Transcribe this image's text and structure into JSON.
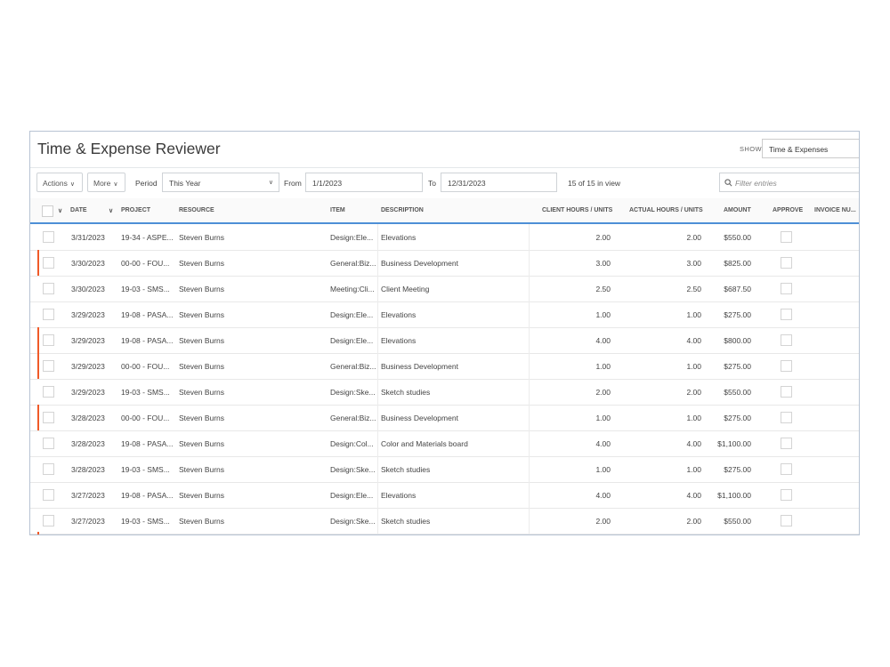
{
  "header": {
    "title": "Time & Expense Reviewer",
    "show_label": "SHOW",
    "show_value": "Time & Expenses"
  },
  "toolbar": {
    "actions_label": "Actions",
    "more_label": "More",
    "period_label": "Period",
    "period_value": "This Year",
    "from_label": "From",
    "from_value": "1/1/2023",
    "to_label": "To",
    "to_value": "12/31/2023",
    "count_text": "15 of 15 in view",
    "filter_placeholder": "Filter entries"
  },
  "columns": {
    "date": "DATE",
    "project": "PROJECT",
    "resource": "RESOURCE",
    "item": "ITEM",
    "description": "DESCRIPTION",
    "client_hours": "CLIENT HOURS / UNITS",
    "actual_hours": "ACTUAL HOURS / UNITS",
    "amount": "AMOUNT",
    "approve": "APPROVE",
    "invoice": "INVOICE NU..."
  },
  "rows": [
    {
      "date": "3/31/2023",
      "project": "19-34 - ASPE...",
      "resource": "Steven Burns",
      "item": "Design:Ele...",
      "description": "Elevations",
      "client": "2.00",
      "actual": "2.00",
      "amount": "$550.00",
      "flagged": false
    },
    {
      "date": "3/30/2023",
      "project": "00-00 - FOU...",
      "resource": "Steven Burns",
      "item": "General:Biz...",
      "description": "Business Development",
      "client": "3.00",
      "actual": "3.00",
      "amount": "$825.00",
      "flagged": true
    },
    {
      "date": "3/30/2023",
      "project": "19-03 - SMS...",
      "resource": "Steven Burns",
      "item": "Meeting:Cli...",
      "description": "Client Meeting",
      "client": "2.50",
      "actual": "2.50",
      "amount": "$687.50",
      "flagged": false
    },
    {
      "date": "3/29/2023",
      "project": "19-08 - PASA...",
      "resource": "Steven Burns",
      "item": "Design:Ele...",
      "description": "Elevations",
      "client": "1.00",
      "actual": "1.00",
      "amount": "$275.00",
      "flagged": false
    },
    {
      "date": "3/29/2023",
      "project": "19-08 - PASA...",
      "resource": "Steven Burns",
      "item": "Design:Ele...",
      "description": "Elevations",
      "client": "4.00",
      "actual": "4.00",
      "amount": "$800.00",
      "flagged": true
    },
    {
      "date": "3/29/2023",
      "project": "00-00 - FOU...",
      "resource": "Steven Burns",
      "item": "General:Biz...",
      "description": "Business Development",
      "client": "1.00",
      "actual": "1.00",
      "amount": "$275.00",
      "flagged": true
    },
    {
      "date": "3/29/2023",
      "project": "19-03 - SMS...",
      "resource": "Steven Burns",
      "item": "Design:Ske...",
      "description": "Sketch studies",
      "client": "2.00",
      "actual": "2.00",
      "amount": "$550.00",
      "flagged": false
    },
    {
      "date": "3/28/2023",
      "project": "00-00 - FOU...",
      "resource": "Steven Burns",
      "item": "General:Biz...",
      "description": "Business Development",
      "client": "1.00",
      "actual": "1.00",
      "amount": "$275.00",
      "flagged": true
    },
    {
      "date": "3/28/2023",
      "project": "19-08 - PASA...",
      "resource": "Steven Burns",
      "item": "Design:Col...",
      "description": "Color and Materials board",
      "client": "4.00",
      "actual": "4.00",
      "amount": "$1,100.00",
      "flagged": false
    },
    {
      "date": "3/28/2023",
      "project": "19-03 - SMS...",
      "resource": "Steven Burns",
      "item": "Design:Ske...",
      "description": "Sketch studies",
      "client": "1.00",
      "actual": "1.00",
      "amount": "$275.00",
      "flagged": false
    },
    {
      "date": "3/27/2023",
      "project": "19-08 - PASA...",
      "resource": "Steven Burns",
      "item": "Design:Ele...",
      "description": "Elevations",
      "client": "4.00",
      "actual": "4.00",
      "amount": "$1,100.00",
      "flagged": false
    },
    {
      "date": "3/27/2023",
      "project": "19-03 - SMS...",
      "resource": "Steven Burns",
      "item": "Design:Ske...",
      "description": "Sketch studies",
      "client": "2.00",
      "actual": "2.00",
      "amount": "$550.00",
      "flagged": false
    }
  ],
  "colors": {
    "flag": "#f05a28",
    "header_rule": "#4d8fd6"
  }
}
